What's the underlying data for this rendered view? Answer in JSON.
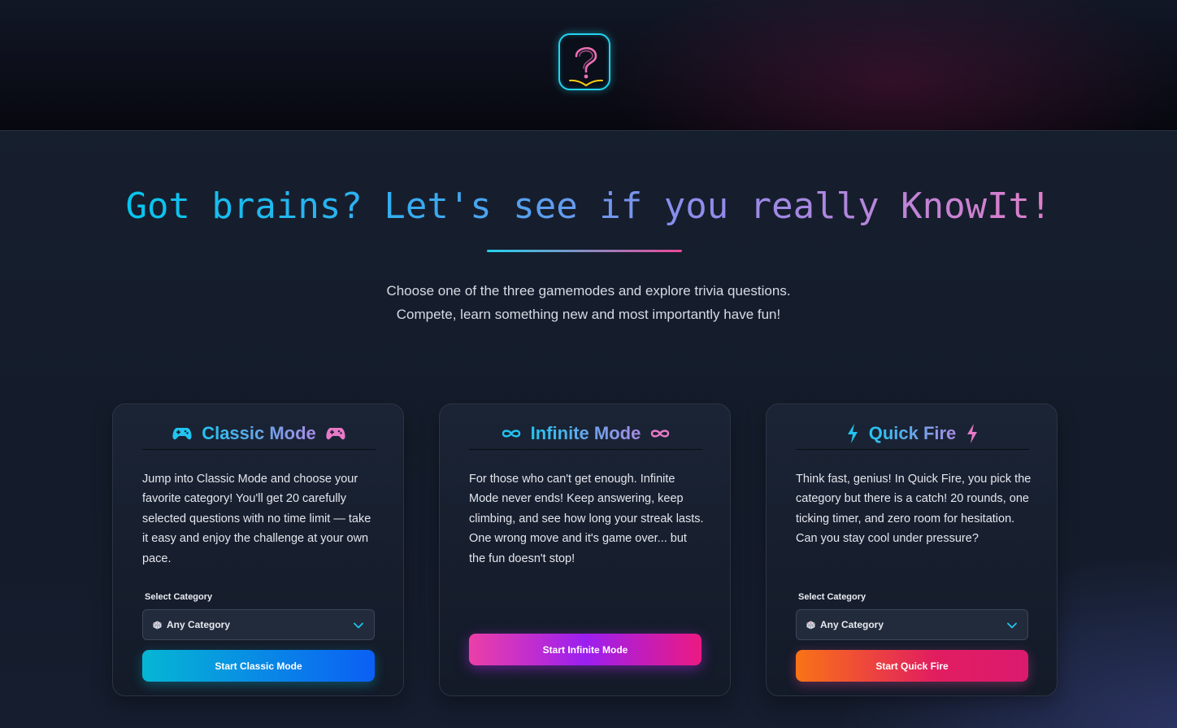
{
  "headline": "Got brains? Let's see if you really KnowIt!",
  "intro": {
    "line1": "Choose one of the three gamemodes and explore trivia questions.",
    "line2": "Compete, learn something new and most importantly have fun!"
  },
  "colors": {
    "accent_cyan": "#22d3ee",
    "accent_pink": "#ec4899",
    "accent_purple": "#9b1ff0",
    "accent_orange": "#f97316"
  },
  "cards": [
    {
      "title": "Classic Mode",
      "icon": "gamepad-icon",
      "description": "Jump into Classic Mode and choose your favorite category! You'll get 20 carefully selected questions with no time limit — take it easy and enjoy the challenge at your own pace.",
      "select_label": "Select Category",
      "select_value": "Any Category",
      "select_icon": "dice-icon",
      "button": "Start Classic Mode"
    },
    {
      "title": "Infinite Mode",
      "icon": "infinity-icon",
      "description": "For those who can't get enough. Infinite Mode never ends! Keep answering, keep climbing, and see how long your streak lasts. One wrong move and it's game over... but the fun doesn't stop!",
      "button": "Start Infinite Mode"
    },
    {
      "title": "Quick Fire",
      "icon": "lightning-icon",
      "description": "Think fast, genius! In Quick Fire, you pick the category but there is a catch! 20 rounds, one ticking timer, and zero room for hesitation. Can you stay cool under pressure?",
      "select_label": "Select Category",
      "select_value": "Any Category",
      "select_icon": "dice-icon",
      "button": "Start Quick Fire"
    }
  ]
}
